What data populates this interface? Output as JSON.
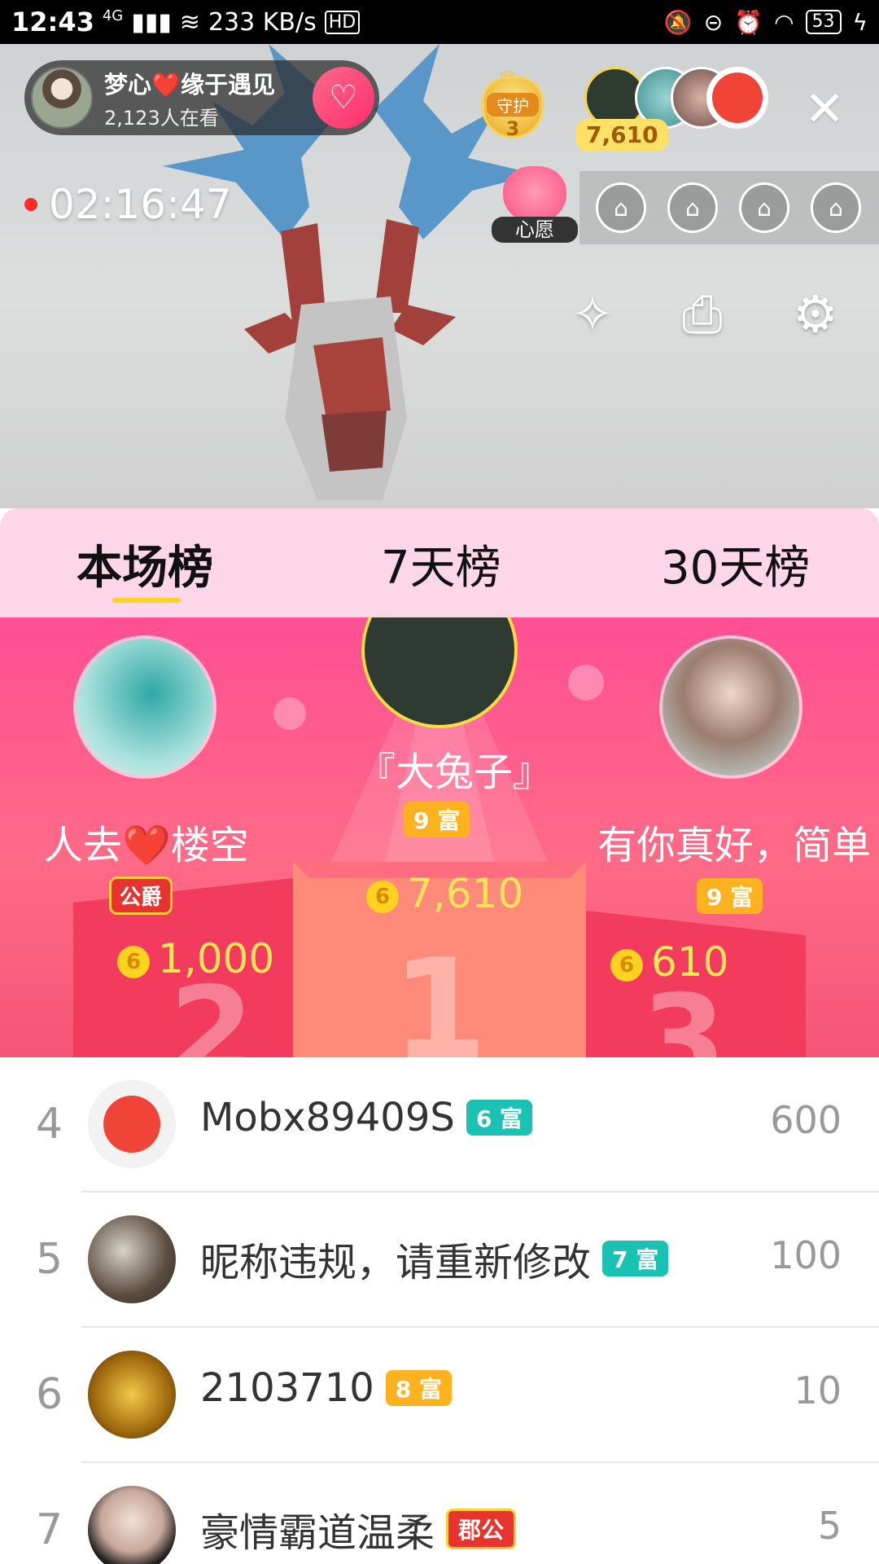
{
  "status_bar": {
    "time": "12:43",
    "network": "4G",
    "speed": "233 KB/s",
    "battery": "53"
  },
  "host": {
    "name": "梦心❤️缘于遇见",
    "viewers": "2,123人在看"
  },
  "guard": {
    "label": "守护",
    "count": "3"
  },
  "audience_count": "7,610",
  "live_timer": "02:16:47",
  "wish_label": "心愿",
  "tabs": [
    {
      "label": "本场榜"
    },
    {
      "label": "7天榜"
    },
    {
      "label": "30天榜"
    }
  ],
  "podium": {
    "first": {
      "name": "『大兔子』",
      "badge": "9 富",
      "score": "7,610"
    },
    "second": {
      "name": "人去❤️楼空",
      "badge": "公爵",
      "score": "1,000"
    },
    "third": {
      "name": "有你真好，简单",
      "badge": "9 富",
      "score": "610"
    }
  },
  "ranking": [
    {
      "rank": "4",
      "name": "Mobx89409S",
      "badge": "6 富",
      "score": "600",
      "badge_color": "#19c2b2"
    },
    {
      "rank": "5",
      "name": "昵称违规，请重新修改",
      "badge": "7 富",
      "score": "100",
      "badge_color": "#19c2b2"
    },
    {
      "rank": "6",
      "name": "2103710",
      "badge": "8 富",
      "score": "10",
      "badge_color": "#ffb21f"
    },
    {
      "rank": "7",
      "name": "豪情霸道温柔",
      "badge": "郡公",
      "score": "5",
      "badge_color": "#e8342e"
    }
  ]
}
